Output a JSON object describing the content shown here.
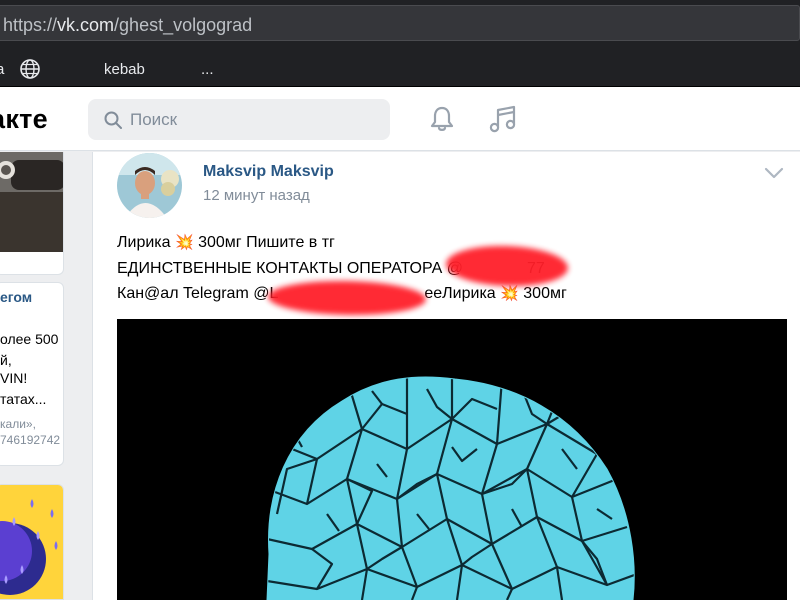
{
  "browser": {
    "url_prefix": "https://",
    "url_host": "vk.com",
    "url_path": "/ghest_volgograd",
    "bookmarks": [
      "a",
      "kebab",
      "..."
    ]
  },
  "header": {
    "logo": "акте",
    "search_placeholder": "Поиск"
  },
  "left_column": {
    "link": "егом",
    "lines": [
      "олее 500",
      "й,",
      "VIN!",
      "татах..."
    ],
    "gray_lines": [
      "кали»,",
      "746192742"
    ]
  },
  "post": {
    "author": "Maksvip Maksvip",
    "time": "12 минут назад",
    "line1_a": "Лирика ",
    "line1_b": " 300мг Пишите в тг",
    "line2": "ЕДИНСТВЕННЫЕ КОНТАКТЫ ОПЕРАТОРА @",
    "line2_tail": "77",
    "line3_a": "Кан@ал Telegram @L",
    "line3_b": "eeЛирика ",
    "line3_c": " 300мг",
    "emoji": "💥"
  },
  "colors": {
    "link": "#2a5885",
    "muted": "#818c99",
    "redaction": "#ff1f2a",
    "shard": "#5fd3e6"
  },
  "icons": [
    "globe-icon",
    "search-icon",
    "bell-icon",
    "music-icon",
    "chevron-down-icon"
  ]
}
